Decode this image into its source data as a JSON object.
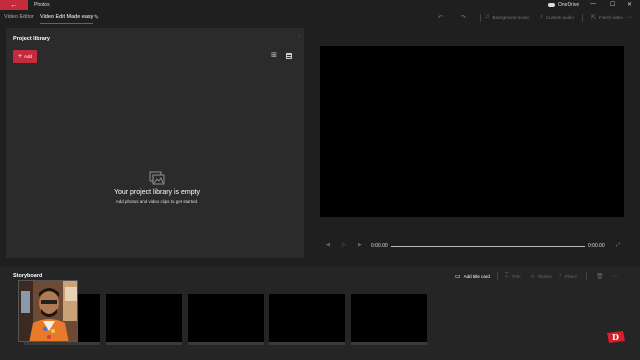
{
  "window": {
    "app_title": "Photos",
    "back_icon": "back-arrow-icon",
    "onedrive_label": "OneDrive",
    "controls": [
      "—",
      "☐",
      "✕"
    ]
  },
  "tabs": [
    {
      "label": "Video Editor",
      "active": false
    },
    {
      "label": "Video Edit Made easy",
      "active": true
    }
  ],
  "toolbar": {
    "background_music": "Background music",
    "custom_audio": "Custom audio",
    "finish_video": "Finish video"
  },
  "library": {
    "title": "Project library",
    "add_label": "Add",
    "empty_title": "Your project library is empty",
    "empty_subtitle": "Add photos and video clips to get started."
  },
  "preview": {
    "current_time": "0:00.00",
    "total_time": "0:00.00",
    "progress": 0
  },
  "storyboard": {
    "title": "Storyboard",
    "add_title_card": "Add title card",
    "trim": "Trim",
    "resize": "Resize",
    "filters": "Filters",
    "clip_count": 5
  },
  "colors": {
    "accent": "#c42b3c",
    "background": "#1f1f1f",
    "panel": "#2b2b2b"
  }
}
